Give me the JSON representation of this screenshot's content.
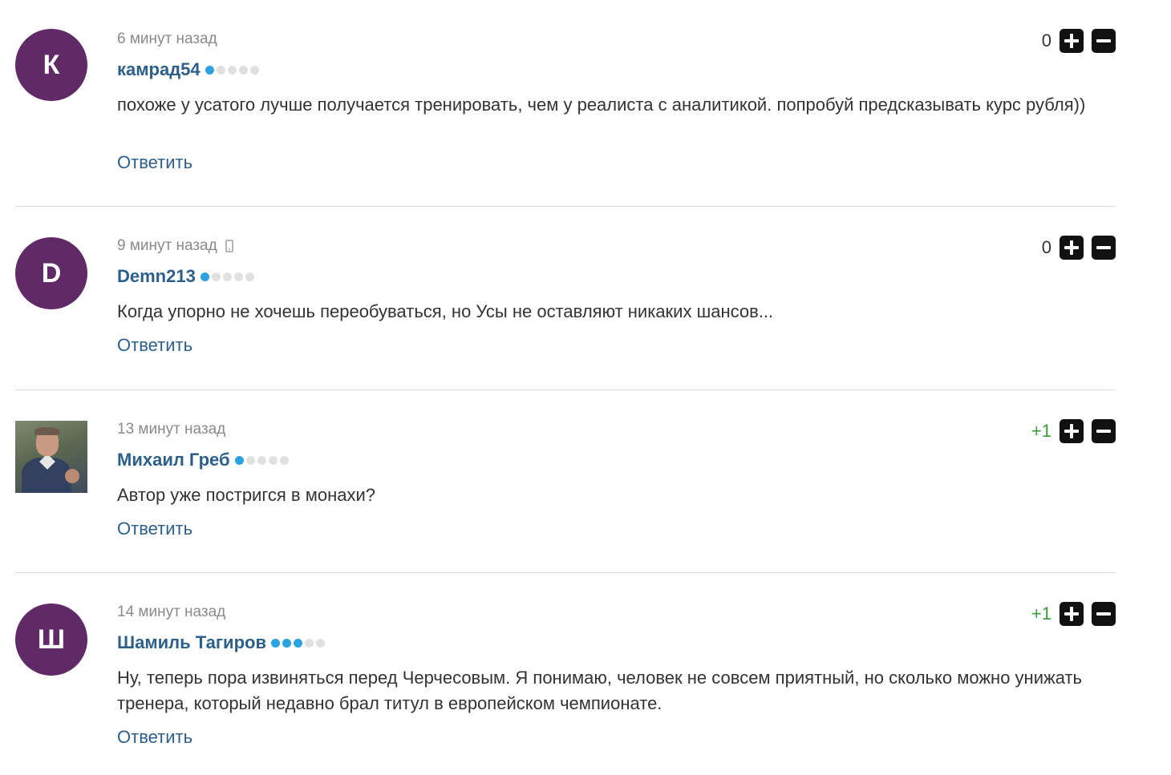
{
  "comments": [
    {
      "avatar_letter": "К",
      "time": "6 минут назад",
      "author": "камрад54",
      "rating_level": 1,
      "text": "похоже у усатого лучше получается тренировать, чем у реалиста с аналитикой. попробуй предсказывать курс рубля))",
      "reply": "Ответить",
      "score": "0"
    },
    {
      "avatar_letter": "D",
      "time": "9 минут назад",
      "author": "Demn213",
      "rating_level": 1,
      "text": "Когда упорно не хочешь переобуваться, но Усы не оставляют никаких шансов...",
      "reply": "Ответить",
      "score": "0"
    },
    {
      "avatar_letter": "",
      "time": "13 минут назад",
      "author": "Михаил Греб",
      "rating_level": 1,
      "text": "Автор уже постригся в монахи?",
      "reply": "Ответить",
      "score": "+1"
    },
    {
      "avatar_letter": "Ш",
      "time": "14 минут назад",
      "author": "Шамиль Тагиров",
      "rating_level": 3,
      "text": "Ну, теперь пора извиняться перед Черчесовым. Я понимаю, человек не совсем приятный, но сколько можно унижать тренера, который недавно брал титул в европейском чемпионате.",
      "reply": "Ответить",
      "score": "+1"
    }
  ],
  "colors": {
    "avatar_bg": "#5f2a66",
    "author": "#2c5f8a",
    "rating_on": "#2ba3e0",
    "rating_off": "#e0e0e0",
    "score_positive": "#3a9a3a"
  },
  "icons": {
    "upvote": "plus-icon",
    "downvote": "minus-icon",
    "device": "mobile-phone-icon"
  }
}
